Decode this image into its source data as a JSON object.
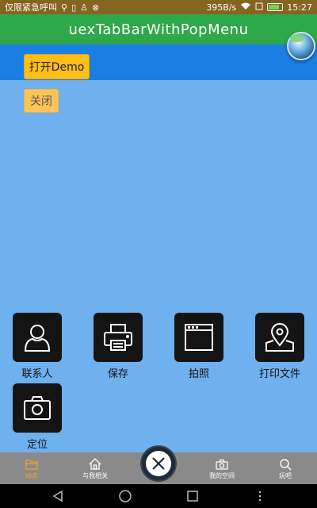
{
  "status_bar": {
    "carrier_text": "仅限紧急呼叫",
    "net_speed": "395B/s",
    "time": "15:27"
  },
  "title_bar": {
    "title": "uexTabBarWithPopMenu"
  },
  "buttons": {
    "open_label": "打开Demo",
    "close_label": "关闭"
  },
  "popup_menu": {
    "items": [
      {
        "label": "联系人",
        "icon": "person-icon"
      },
      {
        "label": "保存",
        "icon": "printer-icon"
      },
      {
        "label": "拍照",
        "icon": "window-icon"
      },
      {
        "label": "打印文件",
        "icon": "map-pin-icon"
      },
      {
        "label": "定位",
        "icon": "camera-icon"
      }
    ]
  },
  "tab_bar": {
    "tabs": [
      {
        "label": "动态",
        "icon": "folder-icon",
        "active": true
      },
      {
        "label": "与我相关",
        "icon": "home-icon",
        "active": false
      },
      {
        "label": "我的空间",
        "icon": "camera-icon",
        "active": false
      },
      {
        "label": "玩吧",
        "icon": "search-icon",
        "active": false
      }
    ],
    "center_icon": "close-icon"
  },
  "colors": {
    "title_bar": "#2ea84a",
    "header_band": "#1a7fe3",
    "content_bg": "#6fb0ef",
    "button": "#ffbe1a",
    "tab_bar": "#8a8a8a",
    "tab_active": "#f0a030"
  }
}
